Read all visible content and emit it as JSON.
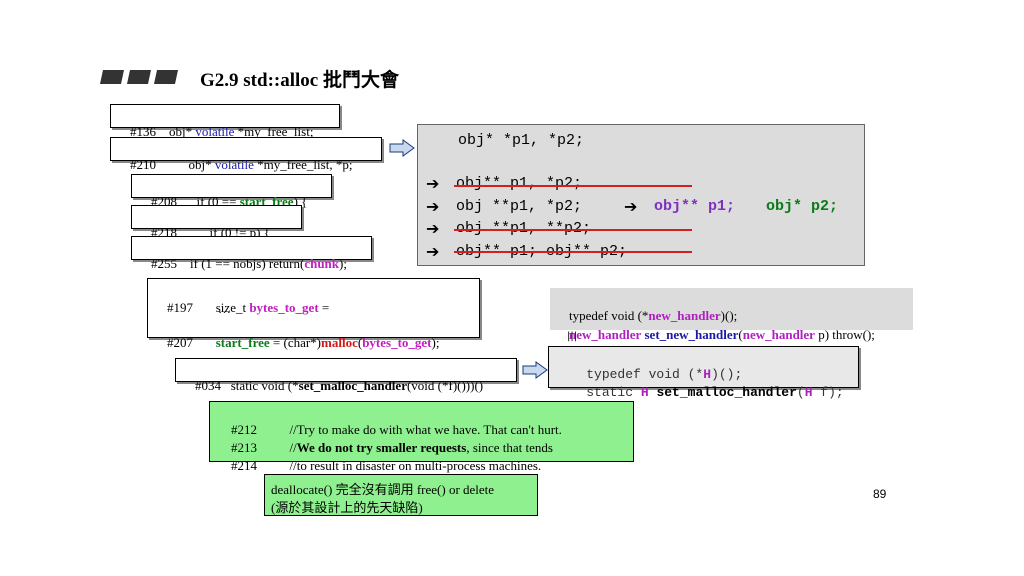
{
  "title": "G2.9 std::alloc 批鬥大會",
  "page_number": "89",
  "snippets": {
    "s136": {
      "num": "#136",
      "pre": "obj* ",
      "kw": "volatile",
      "post": " *my_free_list;"
    },
    "s210": {
      "num": "#210",
      "pre": "obj* ",
      "kw": "volatile",
      "post": " *my_free_list, *p;"
    },
    "s208": {
      "num": "#208",
      "pre": "if (0 == ",
      "hl": "start_free",
      "post": ") {"
    },
    "s218": {
      "num": "#218",
      "code": "if (0 != p) {"
    },
    "s255": {
      "num": "#255",
      "pre": "if (1 == nobjs) return(",
      "hl": "chunk",
      "post": ");"
    }
  },
  "gray_box": {
    "line1": "obj* *p1, *p2;",
    "line2": "obj** p1, *p2;",
    "line3a": "obj **p1, *p2;",
    "line3b1": "obj** p1;",
    "line3b2": "obj* p2;",
    "line4": "obj **p1, **p2;",
    "line5": "obj** p1; obj** p2;"
  },
  "alloc_box": {
    "r1_num": "#197",
    "r1_pre": "size_t ",
    "r1_hl": "bytes_to_get",
    "r1_post": " =",
    "r2": "…",
    "r3_num": "#207",
    "r3_a": "start_free",
    "r3_b": " = (char*)",
    "r3_c": "malloc",
    "r3_d": "(",
    "r3_e": "bytes_to_get",
    "r3_f": ");"
  },
  "typedef_box": {
    "l1_a": "typedef void (*",
    "l1_b": "new_handler",
    "l1_c": ")();",
    "l2_a": "new_handler",
    "l2_b": " ",
    "l2_c": "set_new_handler",
    "l2_d": "(",
    "l2_e": "new_handler",
    "l2_f": " p) throw();"
  },
  "equiv_symbol": "|||",
  "malloc_handler": {
    "num": "#034",
    "pre": "static void (*",
    "fn": "set_malloc_handler",
    "post": "(void (*f)()))()"
  },
  "mono_box": {
    "l1_a": "typedef void (*",
    "l1_b": "H",
    "l1_c": ")();",
    "l2_a": "static ",
    "l2_b": "H",
    "l2_c": " ",
    "l2_d": "set_malloc_handler",
    "l2_e": "(",
    "l2_f": "H",
    "l2_g": " f);"
  },
  "comment_box": {
    "rows": [
      {
        "num": "#212",
        "text_a": "//Try to make do with what we have. That can't hurt.",
        "text_b": "",
        "text_c": ""
      },
      {
        "num": "#213",
        "text_a": "//",
        "text_b": "We do not try smaller requests",
        "text_c": ", since that tends"
      },
      {
        "num": "#214",
        "text_a": "//to result in disaster on multi-process machines.",
        "text_b": "",
        "text_c": ""
      }
    ]
  },
  "dealloc_box": {
    "l1": "deallocate() 完全沒有調用 free() or delete",
    "l2": "(源於其設計上的先天缺陷)"
  },
  "colors": {
    "gray_box": "#dcdcdc",
    "green_box": "#8ff08f",
    "title_bar": "#333333",
    "arrow_fill": "#c8d8ee"
  }
}
